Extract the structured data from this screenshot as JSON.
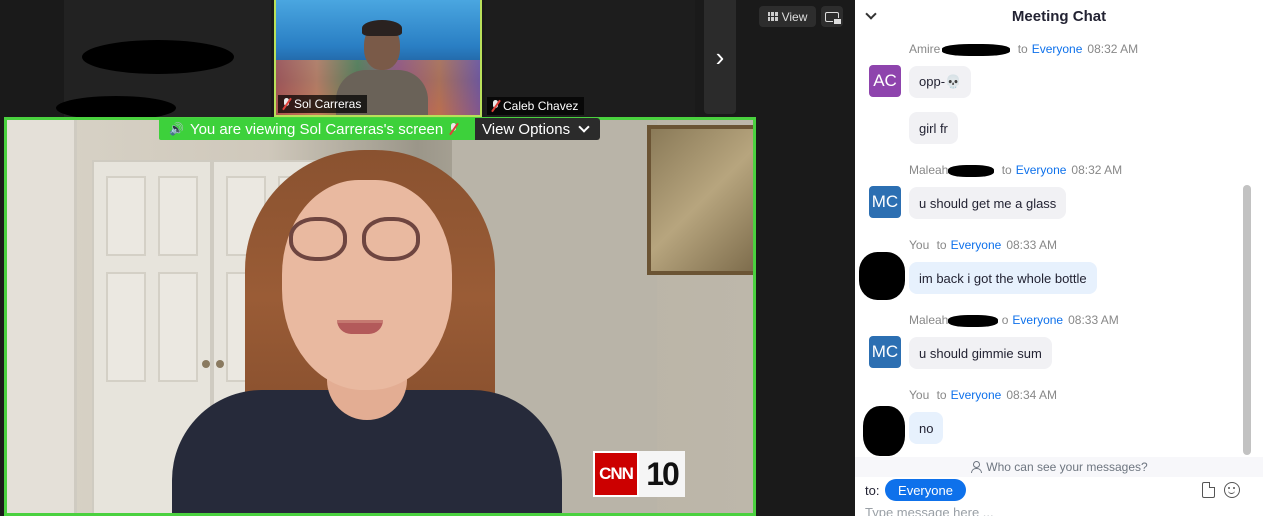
{
  "video": {
    "participants": [
      {
        "name": "Sol Carreras",
        "muted": true
      },
      {
        "name": "Caleb Chavez",
        "muted": true
      }
    ],
    "view_button_label": "View",
    "viewing_banner": "You are viewing Sol Carreras's screen",
    "view_options_label": "View Options",
    "next_page_glyph": "›",
    "shared_content_logo": {
      "brand": "CNN",
      "number": "10"
    }
  },
  "chat": {
    "title": "Meeting Chat",
    "messages": [
      {
        "sender": "Amire",
        "to": "to",
        "recipient": "Everyone",
        "time": "08:32 AM",
        "avatar": "AC",
        "avatar_color": "#8e44ad",
        "lines": [
          "opp-💀",
          "girl fr"
        ]
      },
      {
        "sender": "Maleah",
        "to": "to",
        "recipient": "Everyone",
        "time": "08:32 AM",
        "avatar": "MC",
        "avatar_color": "#2c6fb2",
        "lines": [
          "u should get me a glass"
        ]
      },
      {
        "sender": "You",
        "to": "to",
        "recipient": "Everyone",
        "time": "08:33 AM",
        "avatar": "",
        "lines": [
          "im back i got the whole bottle"
        ]
      },
      {
        "sender": "Maleah",
        "to": "o",
        "recipient": "Everyone",
        "time": "08:33 AM",
        "avatar": "MC",
        "avatar_color": "#2c6fb2",
        "lines": [
          "u should gimmie sum"
        ]
      },
      {
        "sender": "You",
        "to": "to",
        "recipient": "Everyone",
        "time": "08:34 AM",
        "avatar": "",
        "lines": [
          "no"
        ]
      }
    ],
    "privacy_note": "Who can see your messages?",
    "to_label": "to:",
    "recipient": "Everyone",
    "input_placeholder": "Type message here ..."
  },
  "colors": {
    "accent": "#0e71eb",
    "share_border": "#4ad13f",
    "active_speaker_border": "#b9e05a"
  }
}
